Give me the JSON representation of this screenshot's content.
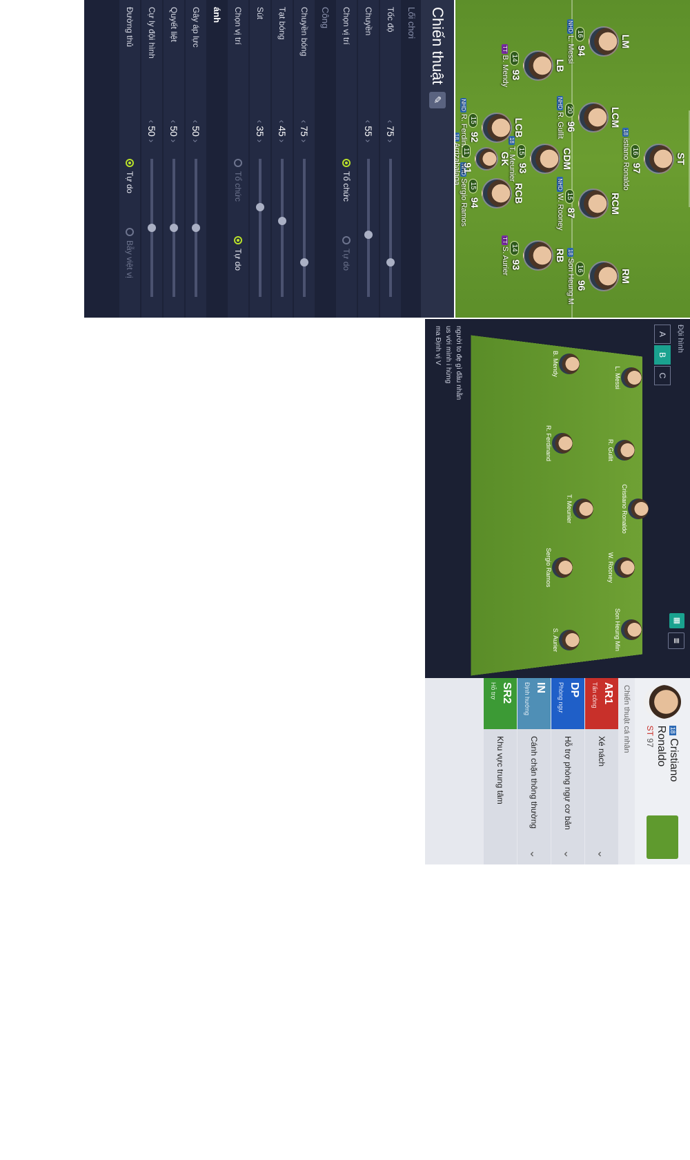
{
  "lineup": {
    "players": [
      {
        "pos": "ST",
        "num": "16",
        "ovr": "97",
        "name": "istiano Ronaldo",
        "tag": "18"
      },
      {
        "pos": "LM",
        "num": "16",
        "ovr": "94",
        "name": "L. Messi",
        "tag": "NHD"
      },
      {
        "pos": "LCM",
        "num": "20",
        "ovr": "96",
        "name": "R. Gullit",
        "tag": "NHD"
      },
      {
        "pos": "RCM",
        "num": "15",
        "ovr": "87",
        "name": "W. Rooney",
        "tag": "NHD"
      },
      {
        "pos": "RM",
        "num": "16",
        "ovr": "96",
        "name": "Son Heung M",
        "tag": "18"
      },
      {
        "pos": "CDM",
        "num": "15",
        "ovr": "93",
        "name": "T. Meunier",
        "tag": "18"
      },
      {
        "pos": "LB",
        "num": "14",
        "ovr": "93",
        "name": "B. Mendy",
        "tag": "TT"
      },
      {
        "pos": "LCB",
        "num": "15",
        "ovr": "92",
        "name": "R. Ferdinand",
        "tag": "NHD"
      },
      {
        "pos": "RCB",
        "num": "15",
        "ovr": "94",
        "name": "Sergio Ramos",
        "tag": "NHD"
      },
      {
        "pos": "RB",
        "num": "14",
        "ovr": "93",
        "name": "S. Aurier",
        "tag": "TT"
      },
      {
        "pos": "GK",
        "num": "11",
        "ovr": "91",
        "name": "Arrizabalaga",
        "tag": "18"
      }
    ]
  },
  "tactics": {
    "title": "Chiến thuật",
    "section_style": "Lối chơi",
    "section_attack": "Công",
    "section_defense": "ánh",
    "rows_style": [
      {
        "label": "Tốc độ",
        "value": "75",
        "frac": 0.75
      },
      {
        "label": "Chuyền",
        "value": "55",
        "frac": 0.55
      },
      {
        "label": "Chọn vị trí",
        "opt1": "Tổ chức",
        "opt2": "Tự do",
        "sel": 1
      }
    ],
    "rows_attack": [
      {
        "label": "Chuyền bóng",
        "value": "75",
        "frac": 0.75
      },
      {
        "label": "Tạt bóng",
        "value": "45",
        "frac": 0.45
      },
      {
        "label": "Sút",
        "value": "35",
        "frac": 0.35
      },
      {
        "label": "Chọn vị trí",
        "opt1": "Tổ chức",
        "opt2": "Tự do",
        "sel": 2
      }
    ],
    "rows_defense": [
      {
        "label": "Gây áp lực",
        "value": "50",
        "frac": 0.5
      },
      {
        "label": "Quyết liệt",
        "value": "50",
        "frac": 0.5
      },
      {
        "label": "Cự ly đội hình",
        "value": "50",
        "frac": 0.5
      },
      {
        "label": "Đường thủ",
        "opt1": "Tự do",
        "opt2": "Bẫy việt vị",
        "sel": 1
      }
    ]
  },
  "formation": {
    "label": "Đội hình",
    "options": [
      "A",
      "B",
      "C"
    ],
    "selected": "B",
    "players": [
      "L. Messi",
      "R. Gullit",
      "Cristiano Ronaldo",
      "W. Rooney",
      "Son Heung Min",
      "B. Mendy",
      "R. Ferdinand",
      "T. Meunier",
      "Sergio Ramos",
      "S. Aurier"
    ],
    "side_notes": [
      "người to đẹ gì đầu nhằn",
      "us với mình i hừng",
      "ma Định vị V"
    ]
  },
  "individual": {
    "player_name": "Cristiano Ronaldo",
    "player_tag": "18",
    "player_pos": "ST",
    "player_ovr": "97",
    "subtitle": "Chiến thuật cá nhân",
    "items": [
      {
        "code": "AR1",
        "sub": "Tấn công",
        "desc": "Xé nách",
        "color": "#c8302a"
      },
      {
        "code": "DP",
        "sub": "Phòng ngự",
        "desc": "Hỗ trợ phòng ngự cơ bản",
        "color": "#1f5fc8"
      },
      {
        "code": "IN",
        "sub": "Định hướng",
        "desc": "Cánh chặn thông thường",
        "color": "#4f8fb6"
      },
      {
        "code": "SR2",
        "sub": "Hỗ trợ",
        "desc": "Khu vực trung tâm",
        "color": "#3c9a35"
      }
    ]
  }
}
